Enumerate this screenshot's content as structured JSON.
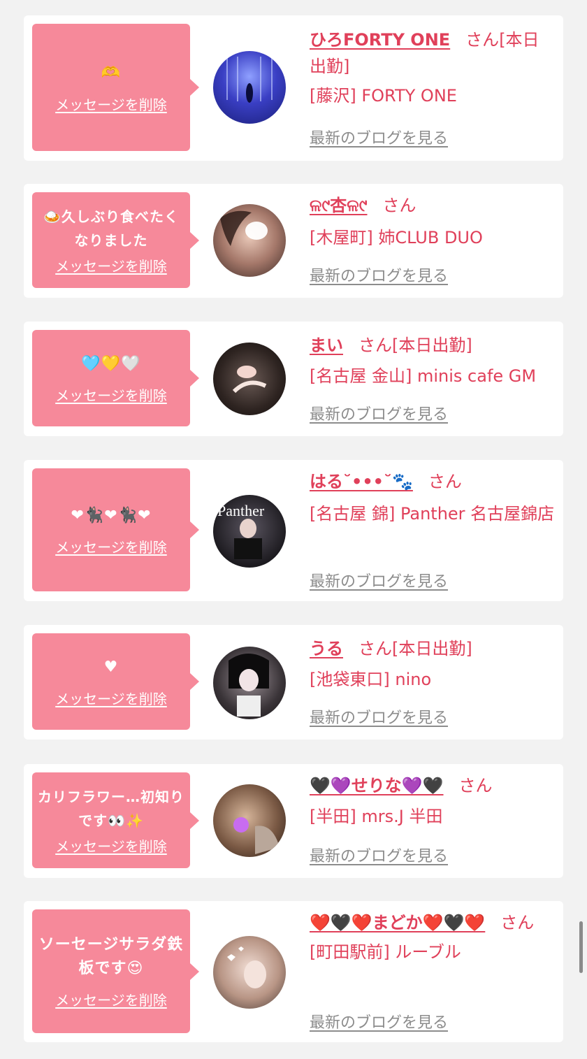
{
  "delete_label": "メッセージを削除",
  "blog_label": "最新のブログを見る",
  "san_label": "さん",
  "cards": [
    {
      "message": "🫶",
      "name": "ひろFORTY ONE",
      "status": "[本日出勤]",
      "shop": "[藤沢] FORTY ONE"
    },
    {
      "message": "🍛久しぶり食べたくなりました",
      "name": "ଳ୯杏ଳ୯",
      "status": "",
      "shop": "[木屋町] 姉CLUB DUO"
    },
    {
      "message": "🩵💛🤍",
      "name": "まい",
      "status": "[本日出勤]",
      "shop": "[名古屋 金山] minis cafe GM"
    },
    {
      "message": "❤🐈‍⬛❤🐈‍⬛❤",
      "name": "はる˘•••˘🐾",
      "status": "",
      "shop": "[名古屋 錦] Panther 名古屋錦店"
    },
    {
      "message": "♥",
      "name": "うる",
      "status": "[本日出勤]",
      "shop": "[池袋東口] nino"
    },
    {
      "message": "カリフラワー…初知りです👀✨",
      "name": "🖤💜せりな💜🖤",
      "status": "",
      "shop": "[半田] mrs.J 半田"
    },
    {
      "message": "ソーセージサラダ鉄板です😍",
      "name": "❤️🖤❤️まどか❤️🖤❤️",
      "status": "",
      "shop": "[町田駅前] ルーブル"
    }
  ],
  "colors": {
    "accent": "#e0405a",
    "bubble": "#f6899a",
    "background": "#f2f2f2"
  }
}
